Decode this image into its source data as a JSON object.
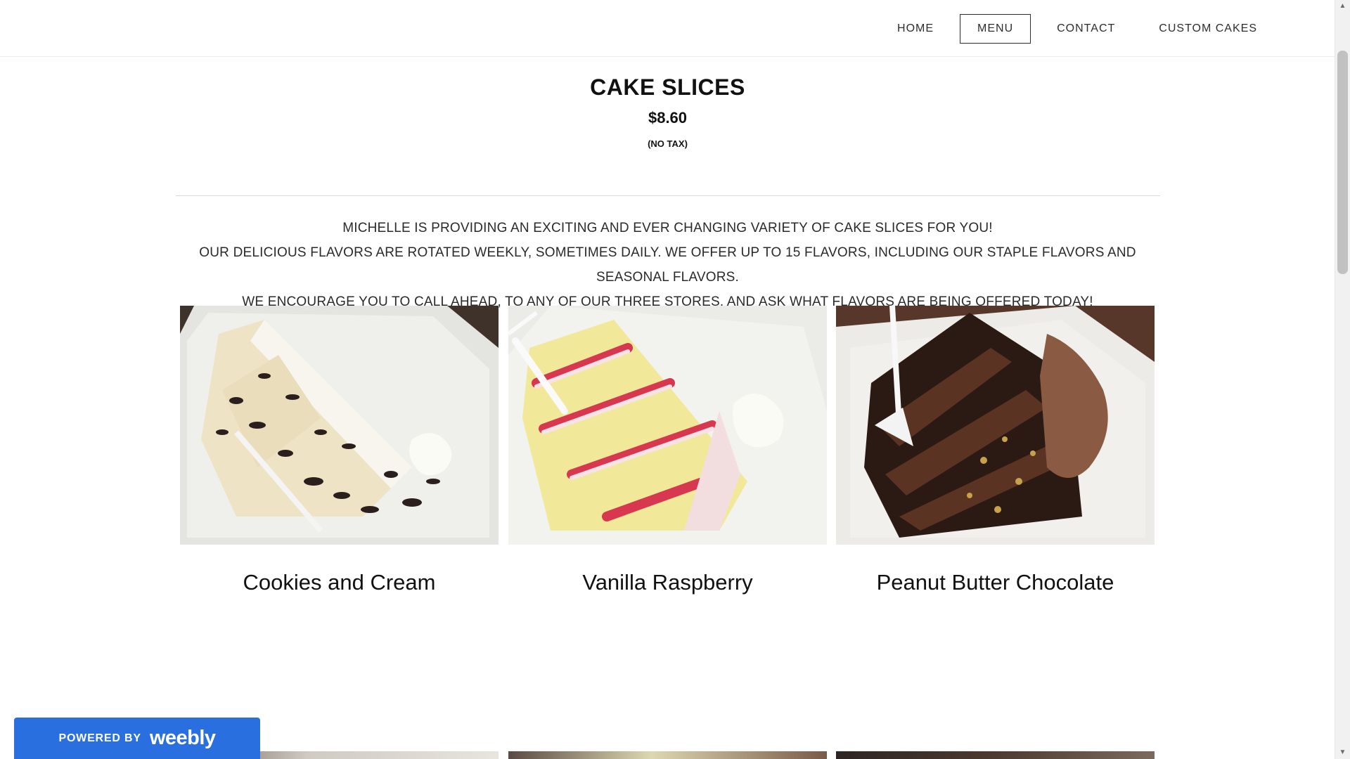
{
  "nav": {
    "items": [
      {
        "label": "HOME",
        "active": false
      },
      {
        "label": "MENU",
        "active": true
      },
      {
        "label": "CONTACT",
        "active": false
      },
      {
        "label": "CUSTOM CAKES",
        "active": false
      }
    ]
  },
  "section": {
    "title": "CAKE SLICES",
    "price": "$8.60",
    "note": "(NO TAX)"
  },
  "description": {
    "line1": "MICHELLE IS PROVIDING AN EXCITING AND EVER CHANGING VARIETY OF CAKE SLICES FOR YOU!",
    "line2": "OUR DELICIOUS FLAVORS ARE ROTATED WEEKLY, SOMETIMES DAILY. WE OFFER UP TO 15 FLAVORS, INCLUDING OUR STAPLE FLAVORS AND SEASONAL FLAVORS.",
    "line3_before": "WE ENCOURAGE YOU TO ",
    "line3_link": "CALL AHEAD",
    "line3_after": ", TO ANY OF OUR THREE STORES, AND ASK WHAT FLAVORS ARE BEING OFFERED TODAY!"
  },
  "flavors": [
    {
      "name": "Cookies and Cream"
    },
    {
      "name": "Vanilla Raspberry"
    },
    {
      "name": "Peanut Butter Chocolate"
    }
  ],
  "badge": {
    "small": "POWERED BY",
    "brand": "weebly"
  },
  "colors": {
    "badge_blue": "#2a6fe0",
    "text_dark": "#111111"
  }
}
